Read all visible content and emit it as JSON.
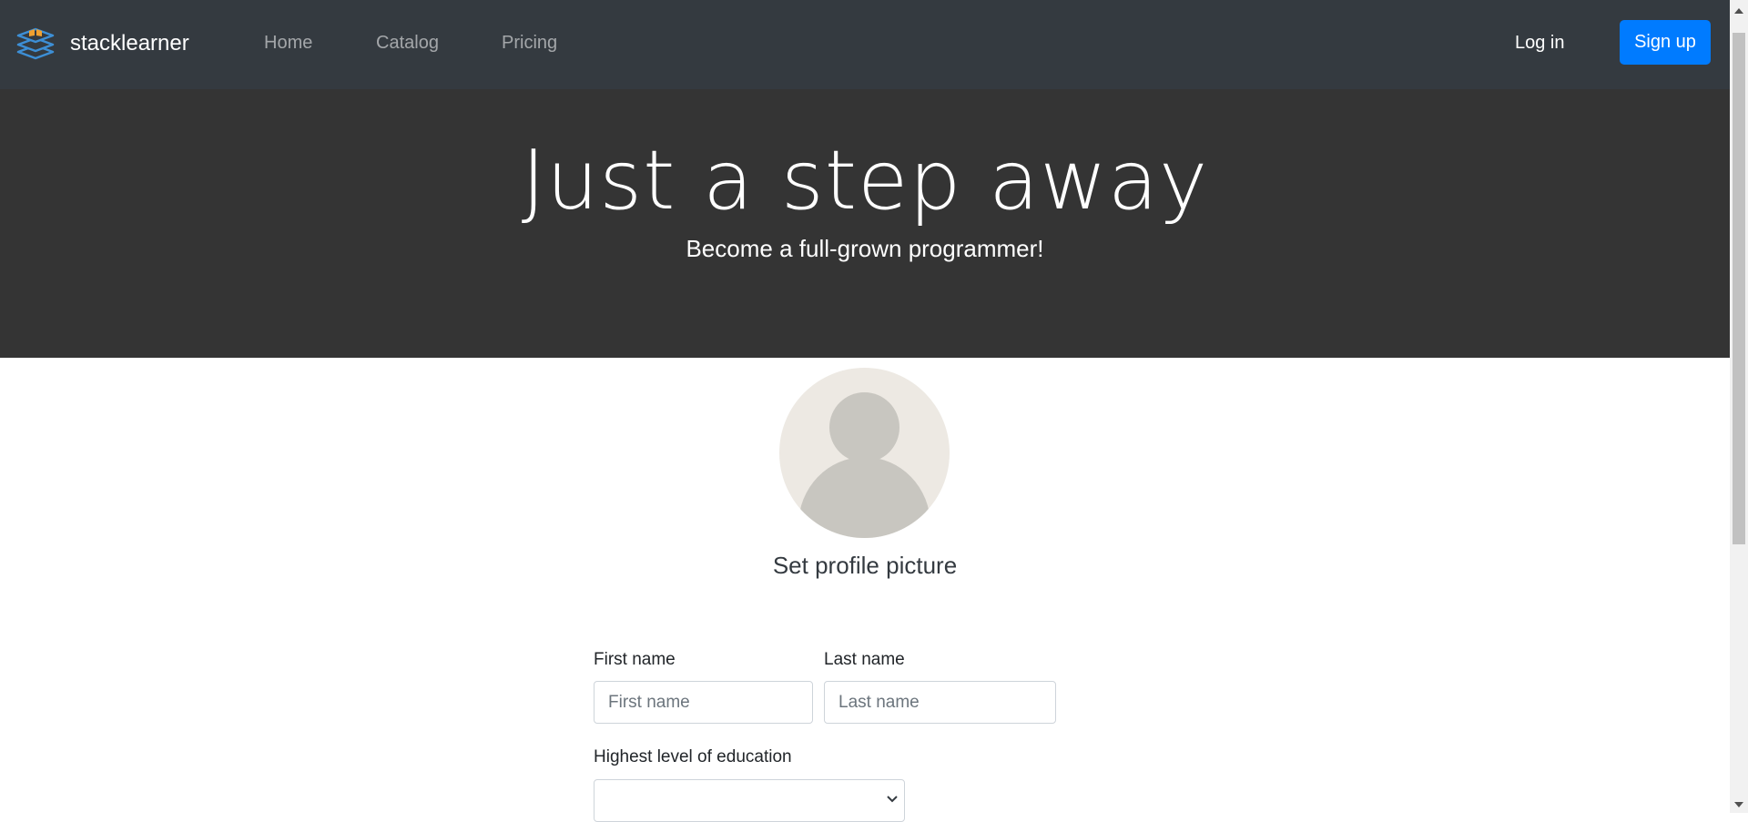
{
  "navbar": {
    "brand": "stacklearner",
    "links": [
      "Home",
      "Catalog",
      "Pricing"
    ],
    "login": "Log in",
    "signup": "Sign up",
    "brand_icon": "stacked-layers-icon"
  },
  "hero": {
    "title": "Just a step away",
    "subtitle": "Become a full-grown programmer!"
  },
  "profile": {
    "set_picture": "Set profile picture",
    "avatar_icon": "default-user-avatar"
  },
  "form": {
    "first_name": {
      "label": "First name",
      "placeholder": "First name",
      "value": ""
    },
    "last_name": {
      "label": "Last name",
      "placeholder": "Last name",
      "value": ""
    },
    "education": {
      "label": "Highest level of education",
      "selected": ""
    }
  },
  "colors": {
    "navbar_bg": "#343a40",
    "hero_bg": "#343434",
    "primary": "#007bff",
    "logo_accent": "#f0a030"
  }
}
